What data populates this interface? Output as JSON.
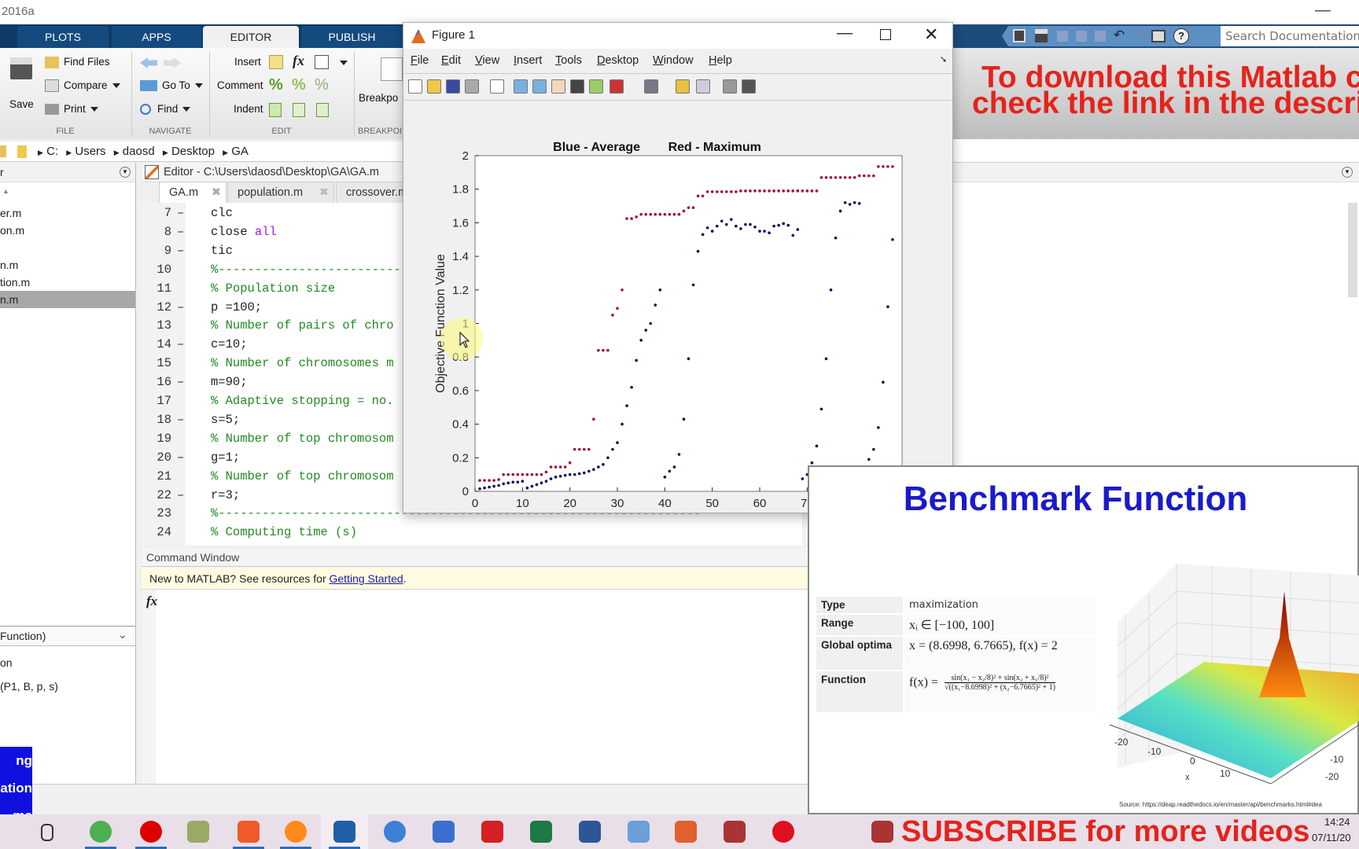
{
  "app": {
    "title_fragment": "2016a"
  },
  "toolstrip": {
    "tabs": [
      {
        "label": "PLOTS"
      },
      {
        "label": "APPS"
      },
      {
        "label": "EDITOR",
        "active": true
      },
      {
        "label": "PUBLISH"
      }
    ],
    "file": {
      "save": "Save",
      "find_files": "Find Files",
      "compare": "Compare",
      "print": "Print",
      "section": "FILE"
    },
    "navigate": {
      "go_to": "Go To",
      "find": "Find",
      "section": "NAVIGATE"
    },
    "edit": {
      "insert": "Insert",
      "comment": "Comment",
      "indent": "Indent",
      "section": "EDIT"
    },
    "breakpoints": {
      "label": "Breakpo",
      "section": "BREAKPOI"
    },
    "search_placeholder": "Search Documentation"
  },
  "breadcrumb": [
    "C:",
    "Users",
    "daosd",
    "Desktop",
    "GA"
  ],
  "current_folder": {
    "header": "r",
    "files": [
      {
        "name": "er.m"
      },
      {
        "name": "on.m"
      },
      {
        "name": ""
      },
      {
        "name": "n.m"
      },
      {
        "name": "tion.m"
      },
      {
        "name": "n.m",
        "selected": true
      }
    ],
    "details_dropdown": "Function)",
    "details_lines": [
      "on",
      "(P1, B, p, s)"
    ]
  },
  "editor": {
    "title": "Editor - C:\\Users\\daosd\\Desktop\\GA\\GA.m",
    "tabs": [
      {
        "label": "GA.m",
        "active": true
      },
      {
        "label": "population.m"
      },
      {
        "label": "crossover.m"
      }
    ],
    "lines": [
      {
        "n": "7",
        "bp": "–",
        "text": "clc",
        "type": "code"
      },
      {
        "n": "8",
        "bp": "–",
        "text": "close ",
        "kw": "all",
        "type": "code"
      },
      {
        "n": "9",
        "bp": "–",
        "text": "tic",
        "type": "code"
      },
      {
        "n": "10",
        "bp": "",
        "text": "%------------------------------------------------------------",
        "type": "comment"
      },
      {
        "n": "11",
        "bp": "",
        "text": "% Population size",
        "type": "comment"
      },
      {
        "n": "12",
        "bp": "–",
        "text": "p =100;",
        "type": "code"
      },
      {
        "n": "13",
        "bp": "",
        "text": "% Number of pairs of chro",
        "type": "comment"
      },
      {
        "n": "14",
        "bp": "–",
        "text": "c=10;",
        "type": "code"
      },
      {
        "n": "15",
        "bp": "",
        "text": "% Number of chromosomes m",
        "type": "comment"
      },
      {
        "n": "16",
        "bp": "–",
        "text": "m=90;",
        "type": "code"
      },
      {
        "n": "17",
        "bp": "",
        "text": "% Adaptive stopping = no.",
        "type": "comment"
      },
      {
        "n": "18",
        "bp": "–",
        "text": "s=5;",
        "type": "code"
      },
      {
        "n": "19",
        "bp": "",
        "text": "% Number of top chromosom",
        "type": "comment"
      },
      {
        "n": "20",
        "bp": "–",
        "text": "g=1;",
        "type": "code"
      },
      {
        "n": "21",
        "bp": "",
        "text": "% Number of top chromosom",
        "type": "comment"
      },
      {
        "n": "22",
        "bp": "–",
        "text": "r=3;",
        "type": "code"
      },
      {
        "n": "23",
        "bp": "",
        "text": "%------------------------------------------------------------------",
        "type": "comment"
      },
      {
        "n": "24",
        "bp": "",
        "text": "% Computing time (s)",
        "type": "comment"
      }
    ]
  },
  "command_window": {
    "title": "Command Window",
    "notice": "New to MATLAB? See resources for ",
    "notice_link": "Getting Started",
    "notice_end": ".",
    "prompt_icon": "fx"
  },
  "figure": {
    "title": "Figure 1",
    "menu": [
      {
        "label": "File",
        "u": "F",
        "rest": "ile"
      },
      {
        "label": "Edit",
        "u": "E",
        "rest": "dit"
      },
      {
        "label": "View",
        "u": "V",
        "rest": "iew"
      },
      {
        "label": "Insert",
        "u": "I",
        "rest": "nsert"
      },
      {
        "label": "Tools",
        "u": "T",
        "rest": "ools"
      },
      {
        "label": "Desktop",
        "u": "D",
        "rest": "esktop"
      },
      {
        "label": "Window",
        "u": "W",
        "rest": "indow"
      },
      {
        "label": "Help",
        "u": "H",
        "rest": "elp"
      }
    ],
    "toolbar_icons": [
      "new-figure-icon",
      "open-icon",
      "save-icon",
      "print-icon",
      "pointer-icon",
      "zoom-in-icon",
      "zoom-out-icon",
      "pan-icon",
      "rotate-icon",
      "data-cursor-icon",
      "brush-icon",
      "link-icon",
      "colorbar-icon",
      "legend-icon",
      "hide-tools-icon",
      "show-tools-icon"
    ]
  },
  "chart_data": {
    "type": "scatter",
    "title": "Blue - Average        Red - Maximum",
    "xlabel": "Generation",
    "ylabel": "Objective Function Value",
    "xlim": [
      0,
      90
    ],
    "ylim": [
      0,
      2
    ],
    "xticks": [
      0,
      10,
      20,
      30,
      40,
      50,
      60,
      70,
      80,
      90
    ],
    "yticks": [
      0,
      0.2,
      0.4,
      0.6,
      0.8,
      1,
      1.2,
      1.4,
      1.6,
      1.8,
      2
    ],
    "ytick_labels": [
      "0",
      "0.2",
      "0.4",
      "0.6",
      "0.8",
      "1",
      "1.2",
      "1.4",
      "1.6",
      "1.8",
      "2"
    ],
    "grid": false,
    "x": [
      1,
      2,
      3,
      4,
      5,
      6,
      7,
      8,
      9,
      10,
      11,
      12,
      13,
      14,
      15,
      16,
      17,
      18,
      19,
      20,
      21,
      22,
      23,
      24,
      25,
      26,
      27,
      28,
      29,
      30,
      31,
      32,
      33,
      34,
      35,
      36,
      37,
      38,
      39,
      40,
      41,
      42,
      43,
      44,
      45,
      46,
      47,
      48,
      49,
      50,
      51,
      52,
      53,
      54,
      55,
      56,
      57,
      58,
      59,
      60,
      61,
      62,
      63,
      64,
      65,
      66,
      67,
      68,
      69,
      70,
      71,
      72,
      73,
      74,
      75,
      76,
      77,
      78,
      79,
      80,
      81,
      82,
      83,
      84,
      85,
      86,
      87,
      88
    ],
    "series": [
      {
        "color": "#a0142e",
        "values": [
          0.065,
          0.065,
          0.065,
          0.065,
          0.07,
          0.1,
          0.1,
          0.1,
          0.1,
          0.1,
          0.1,
          0.1,
          0.1,
          0.1,
          0.115,
          0.145,
          0.145,
          0.145,
          0.145,
          0.17,
          0.25,
          0.25,
          0.25,
          0.25,
          0.43,
          0.84,
          0.84,
          0.84,
          1.05,
          1.09,
          1.2,
          1.625,
          1.625,
          1.635,
          1.65,
          1.65,
          1.65,
          1.65,
          1.65,
          1.65,
          1.65,
          1.65,
          1.65,
          1.67,
          1.69,
          1.69,
          1.76,
          1.76,
          1.785,
          1.785,
          1.785,
          1.785,
          1.785,
          1.785,
          1.785,
          1.79,
          1.79,
          1.79,
          1.79,
          1.79,
          1.79,
          1.79,
          1.79,
          1.79,
          1.79,
          1.79,
          1.79,
          1.79,
          1.79,
          1.79,
          1.79,
          1.79,
          1.87,
          1.87,
          1.87,
          1.87,
          1.87,
          1.87,
          1.87,
          1.87,
          1.88,
          1.88,
          1.88,
          1.88,
          1.935,
          1.935,
          1.935,
          1.935
        ]
      },
      {
        "color": "#0a0a5a",
        "values": [
          0.015,
          0.02,
          0.025,
          0.03,
          0.035,
          0.045,
          0.05,
          0.055,
          0.055,
          0.06,
          0.02,
          0.03,
          0.04,
          0.05,
          0.06,
          0.075,
          0.085,
          0.09,
          0.095,
          0.1,
          0.1,
          0.105,
          0.11,
          0.12,
          0.13,
          0.145,
          0.16,
          0.2,
          0.25,
          0.29,
          0.4,
          0.51,
          0.62,
          0.78,
          0.9,
          0.96,
          1.0,
          1.11,
          1.2,
          0.085,
          0.12,
          0.145,
          0.22,
          0.43,
          0.79,
          1.23,
          1.43,
          1.53,
          1.57,
          1.55,
          1.58,
          1.61,
          1.59,
          1.62,
          1.58,
          1.565,
          1.59,
          1.59,
          1.575,
          1.55,
          1.55,
          1.54,
          1.58,
          1.585,
          1.595,
          1.585,
          1.525,
          1.56,
          0.075,
          0.1,
          0.17,
          0.27,
          0.49,
          0.79,
          1.2,
          1.51,
          1.67,
          1.72,
          1.71,
          1.72,
          1.715,
          0.14,
          0.19,
          0.25,
          0.38,
          0.65,
          1.1,
          1.5
        ]
      }
    ]
  },
  "overlay": {
    "download_line1": "To download this Matlab co",
    "download_line2": "check the link in the descrip",
    "subscribe": "SUBSCRIBE for more videos",
    "side_banner": [
      "ng",
      "ation",
      "ms"
    ]
  },
  "benchmark": {
    "title": "Benchmark Function",
    "rows": [
      {
        "label": "Type",
        "value": "maximization"
      },
      {
        "label": "Range",
        "value": "xᵢ ∈ [−100, 100]"
      },
      {
        "label": "Global optima",
        "value": "x = (8.6998, 6.7665), f(x) = 2"
      },
      {
        "label": "Function",
        "value_lhs": "f(x) =",
        "numerator": "sin(x₁ − x₂/8)² + sin(x₂ + x₁/8)²",
        "denominator": "√((x₁−8.6998)² + (x₂−6.7665)² + 1)"
      }
    ],
    "plot_ticks_x": [
      "-20",
      "-10",
      "0",
      "10"
    ],
    "plot_axis_x": "x",
    "plot_ticks_y": [
      "-10",
      "-20"
    ],
    "source": "Source: https://deap.readthedocs.io/en/master/api/benchmarks.html#dea"
  },
  "taskbar": {
    "icons": [
      "task-view-icon",
      "chrome-icon",
      "recorder-icon",
      "mp3tag-icon",
      "brave-icon",
      "firefox-icon",
      "matlab-icon",
      "app-icon",
      "remote-desktop-icon",
      "autocad-icon",
      "excel-icon",
      "word-icon",
      "pen-tool-icon",
      "media-icon",
      "spider-icon",
      "opera-icon",
      "spider-icon-2"
    ],
    "time": "14:24",
    "date": "07/11/20"
  }
}
